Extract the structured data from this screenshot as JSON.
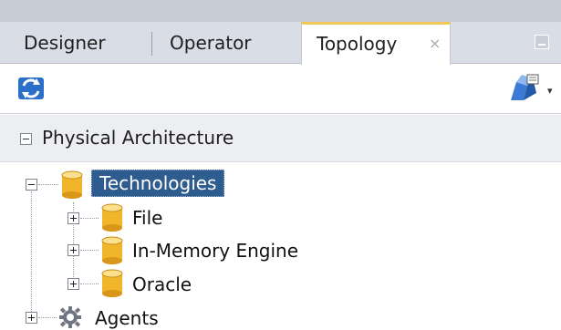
{
  "tabs": {
    "items": [
      {
        "label": "Designer"
      },
      {
        "label": "Operator"
      },
      {
        "label": "Topology",
        "active": true,
        "close": "×"
      }
    ]
  },
  "toolbar": {
    "refresh_icon": "refresh-icon",
    "connect_icon": "connect-icon",
    "dropdown": "▾"
  },
  "section": {
    "title": "Physical Architecture"
  },
  "tree": {
    "root": {
      "label": "Technologies",
      "selected": true
    },
    "children": [
      {
        "label": "File"
      },
      {
        "label": "In-Memory Engine"
      },
      {
        "label": "Oracle"
      }
    ],
    "agents": {
      "label": "Agents"
    }
  },
  "colors": {
    "selection": "#2f5c8f",
    "active_tab_accent": "#f2c75b",
    "db_icon": "#f0b52a"
  }
}
